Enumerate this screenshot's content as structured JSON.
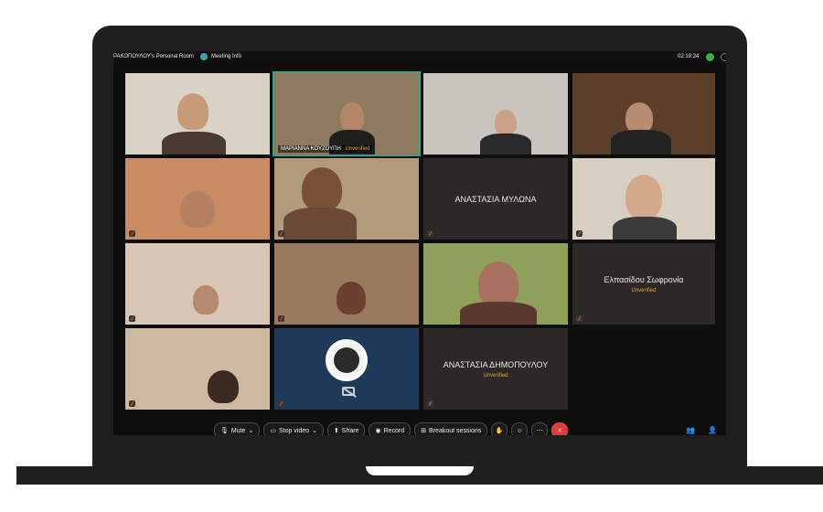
{
  "topbar": {
    "room_title": "ΡΑΚΟΠΟΥΛΟΥ's Personal Room",
    "meeting_info": "Meeting Info",
    "time": "02:19:24"
  },
  "tiles": {
    "t2_label": "ΜΑΡΙΑΝΝΑ ΚΟΥΖΟΥΠΗ",
    "t2_unverified": "Unverified",
    "t7_name": "ΑΝΑΣΤΑΣΙΑ ΜΥΛΩΝΑ",
    "t12_name": "Ελπασίδου Σωφρονία",
    "t12_unverified": "Unverified",
    "t15_name": "ΑΝΑΣΤΑΣΙΑ ΔΗΜΟΠΟΥΛΟΥ",
    "t15_unverified": "Unverified"
  },
  "toolbar": {
    "mute": "Mute",
    "stop_video": "Stop video",
    "share": "Share",
    "record": "Record",
    "breakout": "Breakout sessions"
  },
  "icons": {
    "meeting_info": "info-icon",
    "secure": "shield-check-icon",
    "mic": "mic-icon",
    "video": "video-icon",
    "share": "share-icon",
    "record": "record-icon",
    "breakout": "breakout-icon",
    "end": "close-icon"
  },
  "colors": {
    "accent": "#32a58a",
    "unverified": "#e2a62c",
    "end_call": "#e23b3b"
  }
}
